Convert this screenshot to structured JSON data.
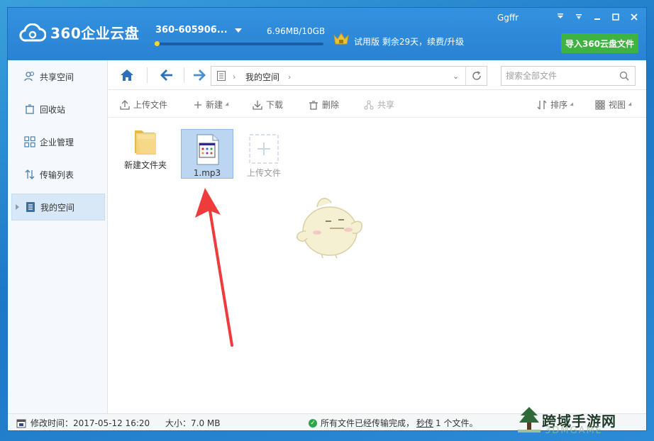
{
  "app": {
    "brand": "360企业云盘",
    "account": "360-605906...",
    "storage": "6.96MB/10GB",
    "storage_used_fraction": 0.01,
    "trial": "试用版 剩余29天，续费/升级",
    "username": "Ggffr",
    "import_button": "导入360云盘文件",
    "accent": "#2d88d8",
    "import_color": "#3fb342"
  },
  "sidebar": {
    "items": [
      {
        "label": "共享空间",
        "icon": "users-icon"
      },
      {
        "label": "回收站",
        "icon": "recycle-bin-icon"
      },
      {
        "label": "企业管理",
        "icon": "grid-icon"
      },
      {
        "label": "传输列表",
        "icon": "transfer-icon"
      },
      {
        "label": "我的空间",
        "icon": "document-icon",
        "active": true
      }
    ]
  },
  "nav": {
    "path": "我的空间",
    "search_placeholder": "搜索全部文件"
  },
  "toolbar": {
    "upload": "上传文件",
    "new": "新建",
    "download": "下载",
    "delete": "删除",
    "share": "共享",
    "sort": "排序",
    "view": "视图"
  },
  "files": [
    {
      "name": "新建文件夹",
      "icon": "folder-icon"
    },
    {
      "name": "1.mp3",
      "icon": "audio-file-icon",
      "selected": true
    },
    {
      "name": "上传文件",
      "icon": "upload-plus-icon"
    }
  ],
  "status": {
    "modified": "修改时间：2017-05-12 16:20",
    "size": "大小：7.0 MB",
    "transfer_prefix": "所有文件已经传输完成，",
    "transfer_link": "秒传",
    "transfer_suffix": "1 个文件。"
  },
  "watermark": {
    "text": "跨域手游网",
    "sub": "3DMGAME"
  }
}
